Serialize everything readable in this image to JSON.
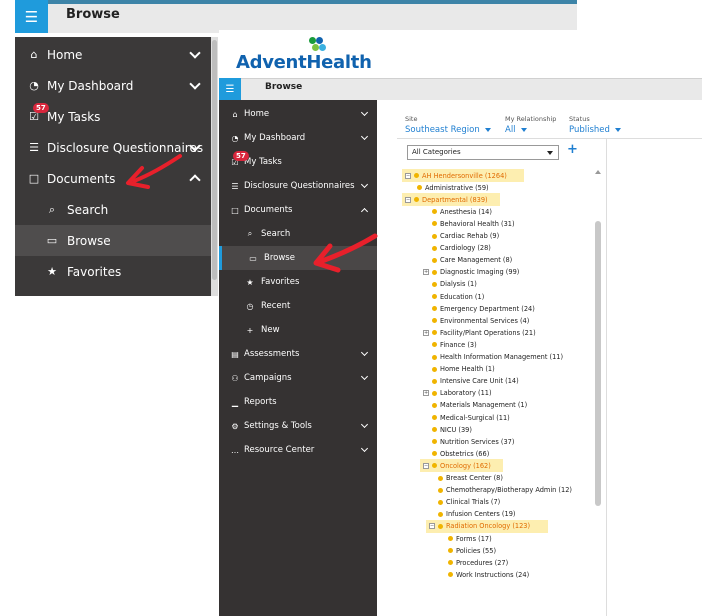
{
  "shot_back": {
    "topbar_title": "Browse",
    "sidebar": [
      {
        "label": "Home",
        "icon": "home-icon",
        "chevron": "down"
      },
      {
        "label": "My Dashboard",
        "icon": "dashboard-icon",
        "chevron": "down"
      },
      {
        "label": "My Tasks",
        "icon": "tasks-icon",
        "badge": "57"
      },
      {
        "label": "Disclosure Questionnaires",
        "icon": "list-icon",
        "chevron": "down"
      },
      {
        "label": "Documents",
        "icon": "document-icon",
        "chevron": "up"
      },
      {
        "label": "Search",
        "icon": "search-icon",
        "sub": true
      },
      {
        "label": "Browse",
        "icon": "folder-icon",
        "sub": true,
        "active": true
      },
      {
        "label": "Favorites",
        "icon": "star-icon",
        "sub": true
      }
    ]
  },
  "shot_front": {
    "logo": "AdventHealth",
    "topbar_title": "Browse",
    "sidebar": [
      {
        "label": "Home",
        "icon": "home-icon",
        "chevron": "down"
      },
      {
        "label": "My Dashboard",
        "icon": "dashboard-icon",
        "chevron": "down"
      },
      {
        "label": "My Tasks",
        "icon": "tasks-icon",
        "badge": "57"
      },
      {
        "label": "Disclosure Questionnaires",
        "icon": "list-icon",
        "chevron": "down"
      },
      {
        "label": "Documents",
        "icon": "document-icon",
        "chevron": "up"
      },
      {
        "label": "Search",
        "icon": "search-icon",
        "sub": true
      },
      {
        "label": "Browse",
        "icon": "folder-icon",
        "sub": true,
        "active": true
      },
      {
        "label": "Favorites",
        "icon": "star-icon",
        "sub": true
      },
      {
        "label": "Recent",
        "icon": "clock-icon",
        "sub": true
      },
      {
        "label": "New",
        "icon": "plus-icon",
        "sub": true
      },
      {
        "label": "Assessments",
        "icon": "clipboard-icon",
        "chevron": "down"
      },
      {
        "label": "Campaigns",
        "icon": "users-icon",
        "chevron": "down"
      },
      {
        "label": "Reports",
        "icon": "chart-icon"
      },
      {
        "label": "Settings & Tools",
        "icon": "gear-icon",
        "chevron": "down"
      },
      {
        "label": "Resource Center",
        "icon": "dots-icon",
        "chevron": "down"
      }
    ],
    "filters": {
      "site_label": "Site",
      "site_value": "Southeast Region",
      "relationship_label": "My Relationship",
      "relationship_value": "All",
      "status_label": "Status",
      "status_value": "Published"
    },
    "category_select": "All Categories",
    "tree": [
      {
        "label": "AH Hendersonville (1264)",
        "level": 0,
        "expander": "minus",
        "highlight": true
      },
      {
        "label": "Administrative (59)",
        "level": 1
      },
      {
        "label": "Departmental (839)",
        "level": 0,
        "expander": "minus",
        "highlight": true
      },
      {
        "label": "Anesthesia (14)",
        "level": 2
      },
      {
        "label": "Behavioral Health (31)",
        "level": 2
      },
      {
        "label": "Cardiac Rehab (9)",
        "level": 2
      },
      {
        "label": "Cardiology (28)",
        "level": 2
      },
      {
        "label": "Care Management (8)",
        "level": 2
      },
      {
        "label": "Diagnostic Imaging (99)",
        "level": 2,
        "expander": "plus"
      },
      {
        "label": "Dialysis (1)",
        "level": 2
      },
      {
        "label": "Education (1)",
        "level": 2
      },
      {
        "label": "Emergency Department (24)",
        "level": 2
      },
      {
        "label": "Environmental Services (4)",
        "level": 2
      },
      {
        "label": "Facility/Plant Operations (21)",
        "level": 2,
        "expander": "plus"
      },
      {
        "label": "Finance (3)",
        "level": 2
      },
      {
        "label": "Health Information Management (11)",
        "level": 2
      },
      {
        "label": "Home Health (1)",
        "level": 2
      },
      {
        "label": "Intensive Care Unit (14)",
        "level": 2
      },
      {
        "label": "Laboratory (11)",
        "level": 2,
        "expander": "plus"
      },
      {
        "label": "Materials Management (1)",
        "level": 2
      },
      {
        "label": "Medical-Surgical (11)",
        "level": 2
      },
      {
        "label": "NICU (39)",
        "level": 2
      },
      {
        "label": "Nutrition Services (37)",
        "level": 2
      },
      {
        "label": "Obstetrics (66)",
        "level": 2
      },
      {
        "label": "Oncology (162)",
        "level": 2,
        "expander": "minus",
        "highlight": true
      },
      {
        "label": "Breast Center (8)",
        "level": 3
      },
      {
        "label": "Chemotherapy/Biotherapy Admin (12)",
        "level": 3
      },
      {
        "label": "Clinical Trials (7)",
        "level": 3
      },
      {
        "label": "Infusion Centers (19)",
        "level": 3
      },
      {
        "label": "Radiation Oncology (123)",
        "level": 3,
        "expander": "minus",
        "highlight": true
      },
      {
        "label": "Forms (17)",
        "level": 4
      },
      {
        "label": "Policies (55)",
        "level": 4
      },
      {
        "label": "Procedures (27)",
        "level": 4
      },
      {
        "label": "Work Instructions (24)",
        "level": 4
      }
    ]
  },
  "colors": {
    "brand_blue": "#1062ae",
    "link_blue": "#1f7fd1",
    "sidebar_dark": "#353232",
    "dot_yellow": "#f0b400",
    "highlight": "#fdeeb0",
    "arrow_red": "#e8202b"
  }
}
